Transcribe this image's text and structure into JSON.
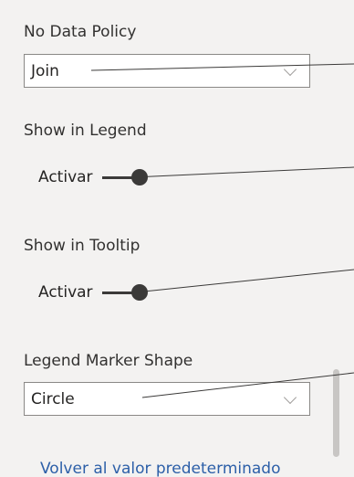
{
  "no_data_policy": {
    "label": "No Data Policy",
    "value": "Join"
  },
  "show_in_legend": {
    "label": "Show in Legend",
    "toggle_text": "Activar"
  },
  "show_in_tooltip": {
    "label": "Show in Tooltip",
    "toggle_text": "Activar"
  },
  "legend_marker_shape": {
    "label": "Legend Marker Shape",
    "value": "Circle"
  },
  "reset_link": "Volver al valor predeterminado",
  "colors": {
    "background": "#f3f2f1",
    "link": "#2c5fa8",
    "toggle": "#3b3a39",
    "border": "#8a8886"
  },
  "icons": {
    "dropdown": "chevron-down-icon"
  }
}
